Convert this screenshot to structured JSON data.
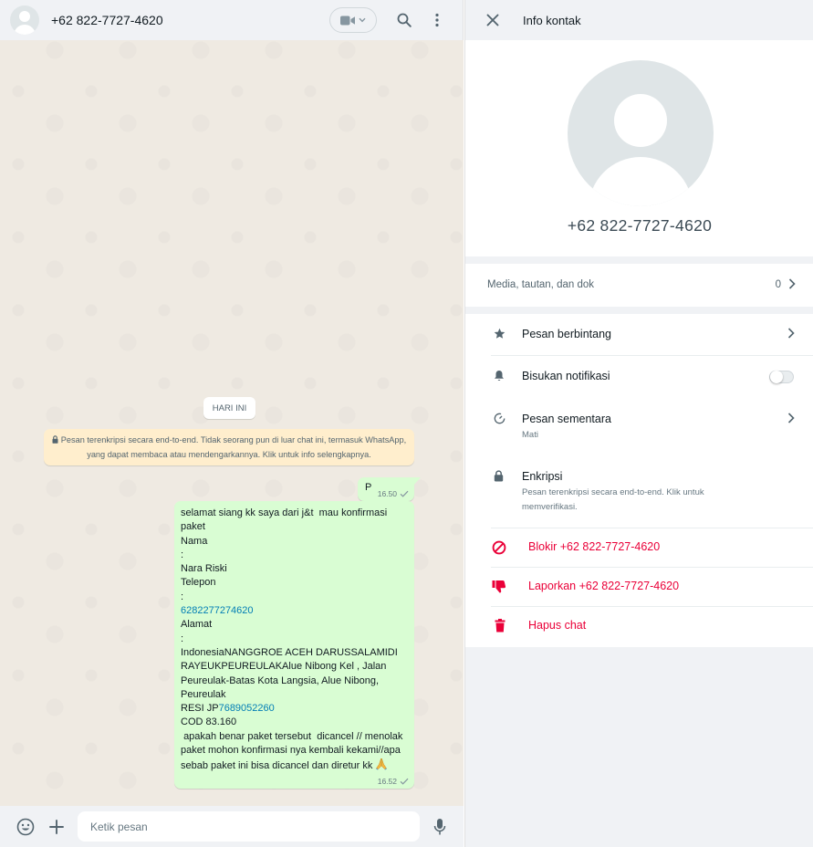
{
  "chat": {
    "contact_name": "+62 822-7727-4620",
    "date_chip": "HARI INI",
    "encryption_notice": "Pesan terenkripsi secara end-to-end. Tidak seorang pun di luar chat ini, termasuk WhatsApp, yang dapat membaca atau mendengarkannya. Klik untuk info selengkapnya.",
    "messages": [
      {
        "text": "P",
        "time": "16.50"
      },
      {
        "time": "16.52",
        "parts": {
          "p1": "selamat siang kk saya dari j&t  mau konfirmasi paket\nNama\n:\nNara Riski\nTelepon\n:\n",
          "phone": "6282277274620",
          "p2": "\nAlamat\n:\nIndonesiaNANGGROE ACEH DARUSSALAMIDI RAYEUKPEUREULAKAlue Nibong Kel , Jalan Peureulak-Batas Kota Langsia, Alue Nibong, Peureulak\nRESI JP",
          "resi": "7689052260",
          "p3": "\nCOD 83.160\n apakah benar paket tersebut  dicancel // menolak paket mohon konfirmasi nya kembali kekami//apa sebab paket ini bisa dicancel dan diretur kk "
        }
      }
    ],
    "composer_placeholder": "Ketik pesan"
  },
  "info": {
    "title": "Info kontak",
    "phone": "+62 822-7727-4620",
    "media_label": "Media, tautan, dan dok",
    "media_count": "0",
    "starred_label": "Pesan berbintang",
    "mute_label": "Bisukan notifikasi",
    "disappearing_label": "Pesan sementara",
    "disappearing_sub": "Mati",
    "encryption_label": "Enkripsi",
    "encryption_sub": "Pesan terenkripsi secara end-to-end. Klik untuk memverifikasi.",
    "block_label": "Blokir +62 822-7727-4620",
    "report_label": "Laporkan +62 822-7727-4620",
    "delete_label": "Hapus chat"
  },
  "colors": {
    "bubble_out": "#d9fdd3",
    "notice": "#ffeecd",
    "danger": "#ea0038",
    "link": "#027eb5",
    "header": "#f0f2f5"
  },
  "icons": [
    "video-icon",
    "search-icon",
    "menu-icon",
    "close-icon",
    "star-icon",
    "bell-icon",
    "timer-icon",
    "lock-icon",
    "block-icon",
    "thumbs-down-icon",
    "trash-icon",
    "emoji-icon",
    "plus-icon",
    "mic-icon"
  ]
}
